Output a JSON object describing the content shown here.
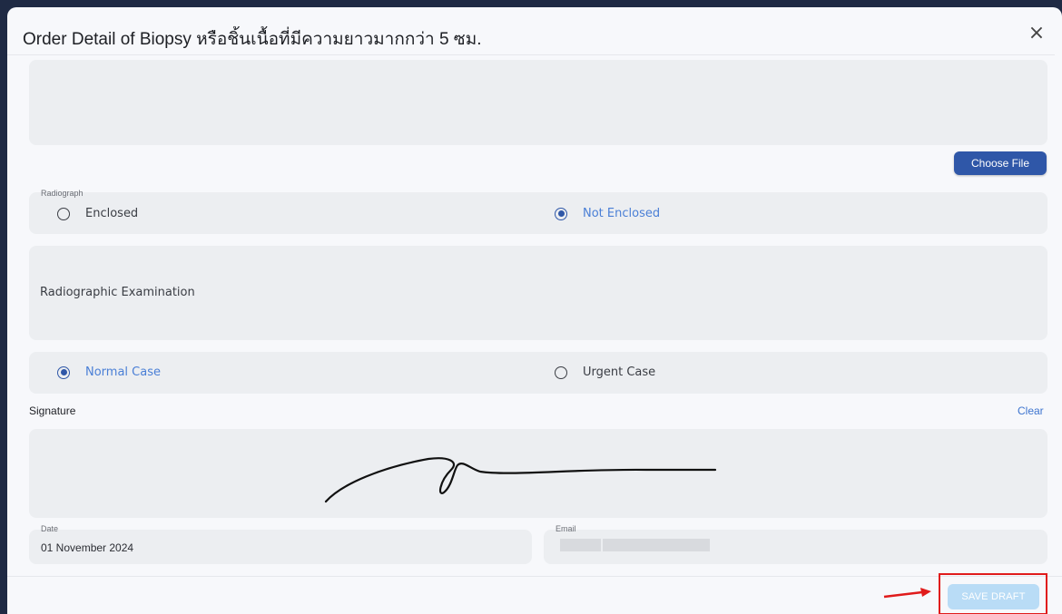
{
  "dialog": {
    "title": "Order Detail of Biopsy หรือชิ้นเนื้อที่มีความยาวมากกว่า 5 ซม.",
    "close_label": "×"
  },
  "upload": {
    "choose_file_label": "Choose File"
  },
  "radiograph": {
    "label": "Radiograph",
    "options": [
      {
        "label": "Enclosed",
        "selected": false
      },
      {
        "label": "Not Enclosed",
        "selected": true
      }
    ]
  },
  "radiographic_examination": {
    "placeholder": "Radiographic Examination"
  },
  "case_type": {
    "options": [
      {
        "label": "Normal Case",
        "selected": true
      },
      {
        "label": "Urgent Case",
        "selected": false
      }
    ]
  },
  "signature": {
    "heading": "Signature",
    "clear_label": "Clear"
  },
  "date_field": {
    "label": "Date",
    "value": "01 November 2024"
  },
  "email_field": {
    "label": "Email"
  },
  "footer": {
    "save_draft_label": "SAVE DRAFT"
  },
  "colors": {
    "primary": "#2f57a8",
    "selected_text": "#4a7fd6",
    "save_draft_bg": "#b9dcf6",
    "highlight": "#e01b1b",
    "field_bg": "#eceef1"
  }
}
